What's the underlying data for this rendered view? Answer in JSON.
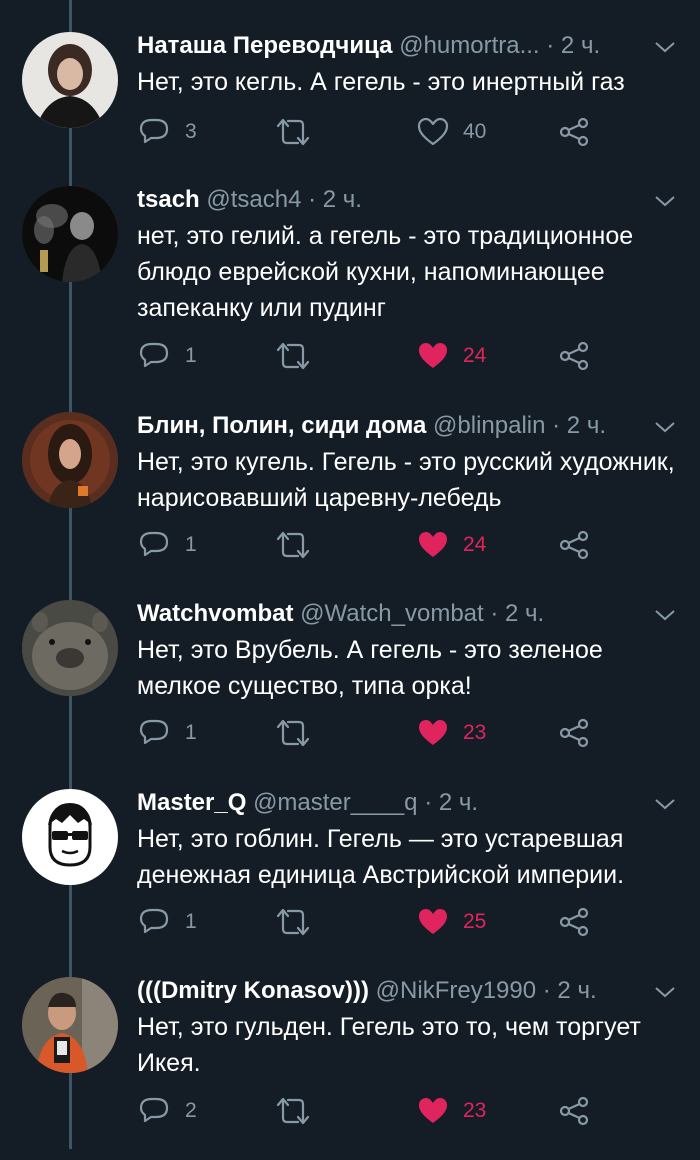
{
  "tweets": [
    {
      "name": "Наташа Переводчица",
      "handle": "@humortra...",
      "time": "· 2 ч.",
      "text": "Нет, это кегль. А гегель - это инертный газ",
      "replies": "3",
      "likes": "40",
      "liked": false
    },
    {
      "name": "tsach",
      "handle": "@tsach4",
      "time": "· 2 ч.",
      "text": "нет, это гелий. а гегель - это традиционное блюдо еврейской кухни, напоминающее запеканку или пудинг",
      "replies": "1",
      "likes": "24",
      "liked": true
    },
    {
      "name": "Блин, Полин, сиди дома",
      "handle": "@blinpalin",
      "time": "· 2 ч.",
      "text": "Нет, это кугель. Гегель - это русский художник, нарисовавший царевну-лебедь",
      "replies": "1",
      "likes": "24",
      "liked": true
    },
    {
      "name": "Watchvombat",
      "handle": "@Watch_vombat",
      "time": "· 2 ч.",
      "text": "Нет, это Врубель. А гегель - это зеленое мелкое существо, типа орка!",
      "replies": "1",
      "likes": "23",
      "liked": true
    },
    {
      "name": "Master_Q",
      "handle": "@master____q",
      "time": "· 2 ч.",
      "text": "Нет, это гоблин. Гегель — это устаревшая денежная единица Австрийской империи.",
      "replies": "1",
      "likes": "25",
      "liked": true
    },
    {
      "name": "(((Dmitry Konasov)))",
      "handle": "@NikFrey1990",
      "time": "· 2 ч.",
      "text": "Нет, это гульден. Гегель это то, чем торгует Икея.",
      "replies": "2",
      "likes": "23",
      "liked": true
    }
  ],
  "colors": {
    "background": "#141d26",
    "secondary_text": "#8899a6",
    "like_active": "#e0245e",
    "thread_line": "#3d5466"
  },
  "icons": [
    "reply-icon",
    "retweet-icon",
    "like-icon",
    "share-icon",
    "chevron-down-icon"
  ]
}
